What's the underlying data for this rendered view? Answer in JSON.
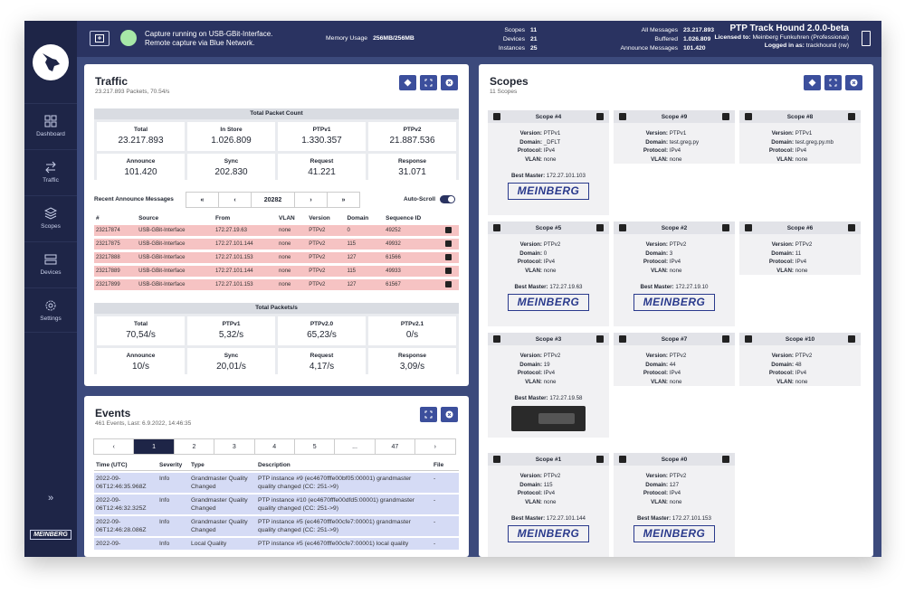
{
  "topbar": {
    "capture_line1": "Capture running on USB-GBit-Interface.",
    "capture_line2": "Remote capture via Blue Network.",
    "mem_label": "Memory Usage",
    "mem_value": "256MB/256MB",
    "scopes_label": "Scopes",
    "scopes_val": "11",
    "devices_label": "Devices",
    "devices_val": "21",
    "instances_label": "Instances",
    "instances_val": "25",
    "all_label": "All Messages",
    "all_val": "23.217.893",
    "buffered_label": "Buffered",
    "buffered_val": "1.026.809",
    "announce_label": "Announce Messages",
    "announce_val": "101.420",
    "app_title": "PTP Track Hound 2.0.0-beta",
    "licensed_label": "Licensed to:",
    "licensed_val": "Meinberg Funkuhren (Professional)",
    "logged_label": "Logged in as:",
    "logged_val": "trackhound (rw)"
  },
  "sidebar": {
    "items": [
      {
        "label": "Dashboard",
        "icon": "dashboard-icon"
      },
      {
        "label": "Traffic",
        "icon": "traffic-icon"
      },
      {
        "label": "Scopes",
        "icon": "layers-icon"
      },
      {
        "label": "Devices",
        "icon": "devices-icon"
      },
      {
        "label": "Settings",
        "icon": "gear-icon"
      }
    ],
    "expand": "»",
    "logo": "MEINBERG"
  },
  "traffic": {
    "title": "Traffic",
    "subtitle": "23.217.893 Packets, 70.54/s",
    "packet_head": "Total Packet Count",
    "counts": [
      {
        "l": "Total",
        "v": "23.217.893"
      },
      {
        "l": "In Store",
        "v": "1.026.809"
      },
      {
        "l": "PTPv1",
        "v": "1.330.357"
      },
      {
        "l": "PTPv2",
        "v": "21.887.536"
      },
      {
        "l": "Announce",
        "v": "101.420"
      },
      {
        "l": "Sync",
        "v": "202.830"
      },
      {
        "l": "Request",
        "v": "41.221"
      },
      {
        "l": "Response",
        "v": "31.071"
      }
    ],
    "recent_label": "Recent Announce Messages",
    "pager": [
      "«",
      "‹",
      "20282",
      "›",
      "»"
    ],
    "autoscroll": "Auto-Scroll",
    "msg_cols": [
      "#",
      "Source",
      "From",
      "VLAN",
      "Version",
      "Domain",
      "Sequence ID"
    ],
    "msg_rows": [
      [
        "23217874",
        "USB-GBit-Interface",
        "172.27.19.63",
        "none",
        "PTPv2",
        "0",
        "49252"
      ],
      [
        "23217875",
        "USB-GBit-Interface",
        "172.27.101.144",
        "none",
        "PTPv2",
        "115",
        "49932"
      ],
      [
        "23217888",
        "USB-GBit-Interface",
        "172.27.101.153",
        "none",
        "PTPv2",
        "127",
        "61566"
      ],
      [
        "23217889",
        "USB-GBit-Interface",
        "172.27.101.144",
        "none",
        "PTPv2",
        "115",
        "49933"
      ],
      [
        "23217899",
        "USB-GBit-Interface",
        "172.27.101.153",
        "none",
        "PTPv2",
        "127",
        "61567"
      ]
    ],
    "rate_head": "Total Packets/s",
    "rates": [
      {
        "l": "Total",
        "v": "70,54/s"
      },
      {
        "l": "PTPv1",
        "v": "5,32/s"
      },
      {
        "l": "PTPv2.0",
        "v": "65,23/s"
      },
      {
        "l": "PTPv2.1",
        "v": "0/s"
      },
      {
        "l": "Announce",
        "v": "10/s"
      },
      {
        "l": "Sync",
        "v": "20,01/s"
      },
      {
        "l": "Request",
        "v": "4,17/s"
      },
      {
        "l": "Response",
        "v": "3,09/s"
      }
    ]
  },
  "events": {
    "title": "Events",
    "subtitle": "461 Events, Last: 6.9.2022, 14:46:35",
    "pager": [
      "‹",
      "1",
      "2",
      "3",
      "4",
      "5",
      "...",
      "47",
      "›"
    ],
    "cols": [
      "Time (UTC)",
      "Severity",
      "Type",
      "Description",
      "File"
    ],
    "rows": [
      [
        "2022-09-06T12:46:35.968Z",
        "Info",
        "Grandmaster Quality Changed",
        "PTP instance #9 (ec4670fffe00bf05:00001) grandmaster quality changed (CC: 251->9)",
        "-"
      ],
      [
        "2022-09-06T12:46:32.325Z",
        "Info",
        "Grandmaster Quality Changed",
        "PTP instance #10 (ec4670fffe00dfd5:00001) grandmaster quality changed (CC: 251->9)",
        "-"
      ],
      [
        "2022-09-06T12:46:28.086Z",
        "Info",
        "Grandmaster Quality Changed",
        "PTP instance #5 (ec4670fffe00cfe7:00001) grandmaster quality changed (CC: 251->9)",
        "-"
      ],
      [
        "2022-09-",
        "Info",
        "Local Quality",
        "PTP instance #5 (ec4670fffe00cfe7:00001) local quality",
        "-"
      ]
    ]
  },
  "scopes": {
    "title": "Scopes",
    "subtitle": "11 Scopes",
    "labels": {
      "version": "Version:",
      "domain": "Domain:",
      "protocol": "Protocol:",
      "vlan": "VLAN:",
      "best": "Best Master:"
    },
    "cards": [
      {
        "name": "Scope #4",
        "version": "PTPv1",
        "domain": "_DFLT",
        "protocol": "IPv4",
        "vlan": "none",
        "best": "172.27.101.103",
        "logo": "MEINBERG"
      },
      {
        "name": "Scope #9",
        "version": "PTPv1",
        "domain": "test.greg.py",
        "protocol": "IPv4",
        "vlan": "none"
      },
      {
        "name": "Scope #8",
        "version": "PTPv1",
        "domain": "test.greg.py.mb",
        "protocol": "IPv4",
        "vlan": "none"
      },
      {
        "name": "Scope #5",
        "version": "PTPv2",
        "domain": "0",
        "protocol": "IPv4",
        "vlan": "none",
        "best": "172.27.19.63",
        "logo": "MEINBERG"
      },
      {
        "name": "Scope #2",
        "version": "PTPv2",
        "domain": "3",
        "protocol": "IPv4",
        "vlan": "none",
        "best": "172.27.19.10",
        "logo": "MEINBERG"
      },
      {
        "name": "Scope #6",
        "version": "PTPv2",
        "domain": "11",
        "protocol": "IPv4",
        "vlan": "none"
      },
      {
        "name": "Scope #3",
        "version": "PTPv2",
        "domain": "19",
        "protocol": "IPv4",
        "vlan": "none",
        "best": "172.27.19.58",
        "device": true
      },
      {
        "name": "Scope #7",
        "version": "PTPv2",
        "domain": "44",
        "protocol": "IPv4",
        "vlan": "none"
      },
      {
        "name": "Scope #10",
        "version": "PTPv2",
        "domain": "48",
        "protocol": "IPv4",
        "vlan": "none"
      },
      {
        "name": "Scope #1",
        "version": "PTPv2",
        "domain": "115",
        "protocol": "IPv4",
        "vlan": "none",
        "best": "172.27.101.144",
        "logo": "MEINBERG"
      },
      {
        "name": "Scope #0",
        "version": "PTPv2",
        "domain": "127",
        "protocol": "IPv4",
        "vlan": "none",
        "best": "172.27.101.153",
        "logo": "MEINBERG"
      }
    ]
  }
}
